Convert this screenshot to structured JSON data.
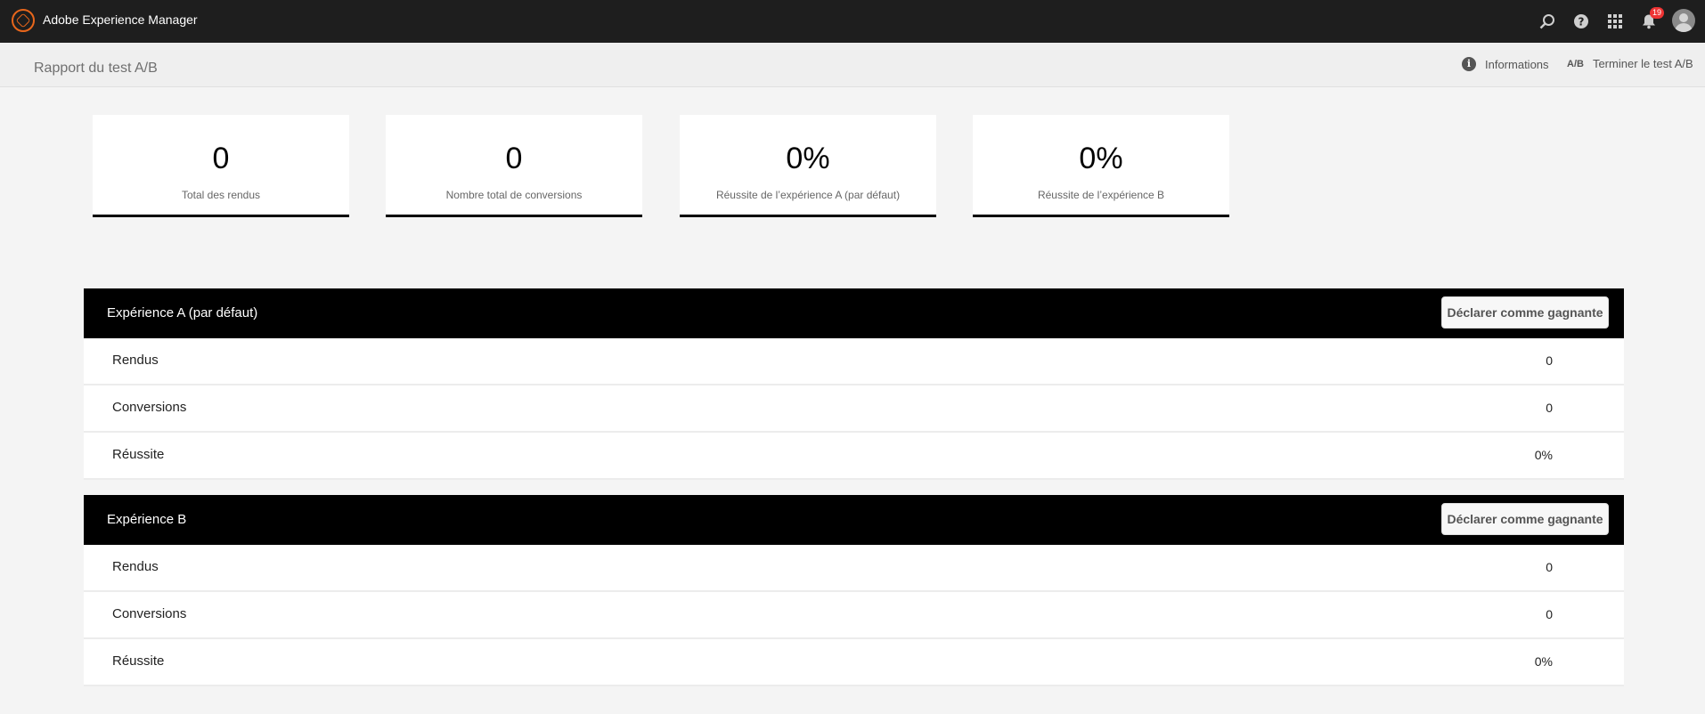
{
  "app": {
    "title": "Adobe Experience Manager"
  },
  "notifications": {
    "count": "19"
  },
  "page": {
    "title": "Rapport du test A/B"
  },
  "actions": {
    "info_label": "Informations",
    "end_test_label": "Terminer le test A/B",
    "ab_icon_text": "A/B"
  },
  "stats": [
    {
      "value": "0",
      "label": "Total des rendus"
    },
    {
      "value": "0",
      "label": "Nombre total de conversions"
    },
    {
      "value": "0%",
      "label": "Réussite de l’expérience A (par défaut)"
    },
    {
      "value": "0%",
      "label": "Réussite de l’expérience B"
    }
  ],
  "experiences": [
    {
      "title": "Expérience A (par défaut)",
      "button": "Déclarer comme gagnante",
      "rows": [
        {
          "label": "Rendus",
          "value": "0"
        },
        {
          "label": "Conversions",
          "value": "0"
        },
        {
          "label": "Réussite",
          "value": "0%"
        }
      ]
    },
    {
      "title": "Expérience B",
      "button": "Déclarer comme gagnante",
      "rows": [
        {
          "label": "Rendus",
          "value": "0"
        },
        {
          "label": "Conversions",
          "value": "0"
        },
        {
          "label": "Réussite",
          "value": "0%"
        }
      ]
    }
  ],
  "colors": {
    "brand": "#e8661b",
    "topbar": "#1e1e1e",
    "badge": "#ee3333"
  }
}
